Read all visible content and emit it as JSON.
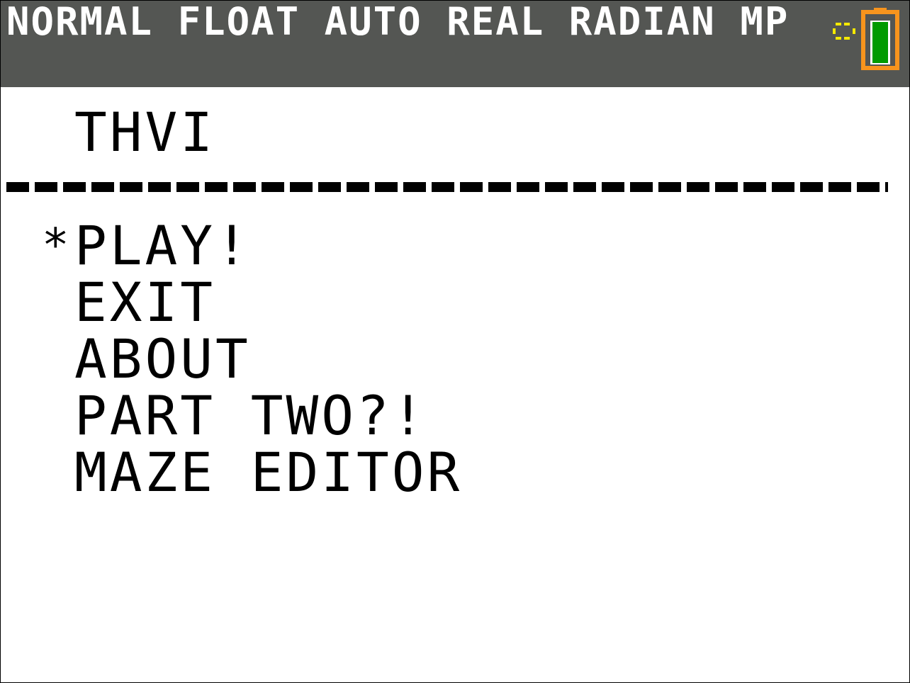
{
  "status_bar": {
    "mode_text": "NORMAL FLOAT AUTO REAL RADIAN MP",
    "busy_icon": "busy-dots-icon",
    "battery_icon": "battery-icon",
    "colors": {
      "background": "#545653",
      "text": "#ffffff",
      "busy": "#f5e900",
      "battery_frame": "#f7941d",
      "battery_fill": "#009a00"
    }
  },
  "screen": {
    "title": "THVI",
    "selection_marker": "*",
    "menu": [
      {
        "label": "PLAY!",
        "selected": true
      },
      {
        "label": "EXIT",
        "selected": false
      },
      {
        "label": "ABOUT",
        "selected": false
      },
      {
        "label": "PART TWO?!",
        "selected": false
      },
      {
        "label": "MAZE EDITOR",
        "selected": false
      }
    ]
  }
}
